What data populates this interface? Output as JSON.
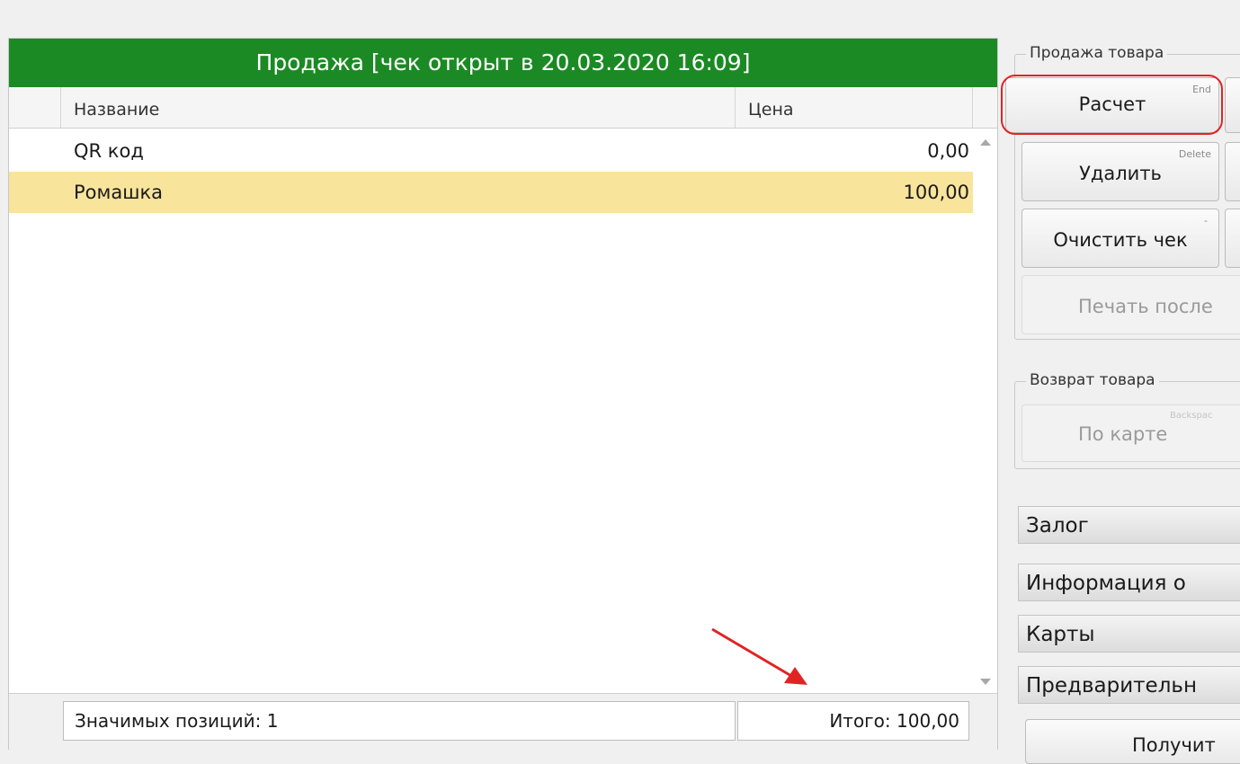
{
  "sale": {
    "header": "Продажа [чек открыт в 20.03.2020 16:09]",
    "columns": {
      "name": "Название",
      "price": "Цена"
    },
    "rows": [
      {
        "name": "QR код",
        "price": "0,00"
      },
      {
        "name": "Ромашка",
        "price": "100,00"
      }
    ],
    "footer": {
      "significant_positions": "Значимых позиций: 1",
      "total": "Итого: 100,00"
    }
  },
  "sale_group": {
    "legend": "Продажа товара",
    "payment": {
      "label": "Расчет",
      "hotkey": "End"
    },
    "delete": {
      "label": "Удалить",
      "hotkey": "Delete"
    },
    "clear": {
      "label": "Очистить чек",
      "hotkey": "-"
    },
    "print_last": {
      "label": "Печать после"
    }
  },
  "return_group": {
    "legend": "Возврат товара",
    "by_card": {
      "label": "По карте",
      "hotkey": "Backspac"
    }
  },
  "accordion": [
    "Залог",
    "Информация о",
    "Карты",
    "Предварительн"
  ],
  "bottom_button": {
    "label": "Получит"
  },
  "colors": {
    "header_green": "#1b8a24",
    "selected_row": "#f8e49b",
    "annotation_red": "#e02424"
  }
}
